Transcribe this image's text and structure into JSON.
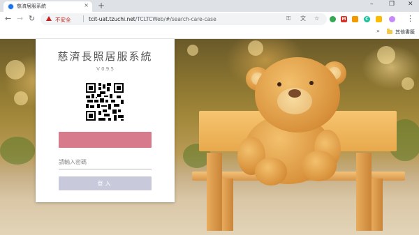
{
  "browser": {
    "tab": {
      "title": "慈濟居服系統",
      "close": "×"
    },
    "new_tab": "+",
    "window_controls": {
      "minimize": "–",
      "maximize": "❐",
      "close": "✕"
    },
    "nav": {
      "back": "←",
      "forward": "→",
      "reload": "↻"
    },
    "address": {
      "security_label": "不安全",
      "host": "tcit-uat.tzuchi.net",
      "path": "/TCLTCWeb/#/search-care-case"
    },
    "extensions": [
      {
        "name": "key-icon",
        "color": "#5f6368"
      },
      {
        "name": "translate-icon",
        "color": "#5f6368"
      },
      {
        "name": "star-icon",
        "color": "#5f6368"
      },
      {
        "name": "chrome-ext-icon",
        "color": "#34a853",
        "letter": ""
      },
      {
        "name": "gmail-icon",
        "color": "#d93025",
        "letter": "M"
      },
      {
        "name": "rss-icon",
        "color": "#f29900",
        "letter": ""
      },
      {
        "name": "grammarly-icon",
        "color": "#15c39a",
        "letter": "C"
      },
      {
        "name": "screenshot-ext-icon",
        "color": "#fbbc04",
        "letter": ""
      },
      {
        "name": "profile-icon",
        "color": "#c58af9",
        "letter": ""
      }
    ],
    "menu": "⋮",
    "bookmarks": {
      "chevron": "»",
      "other_folder": "其他書籤"
    }
  },
  "login": {
    "title": "慈濟長照居服系統",
    "version": "V 0.9.5",
    "account_value": "",
    "password_placeholder": "請輸入密碼",
    "submit_label": "登入"
  },
  "colors": {
    "account_field": "#d77b8c",
    "login_button": "#c9c9dc",
    "insecure": "#c5221f"
  }
}
